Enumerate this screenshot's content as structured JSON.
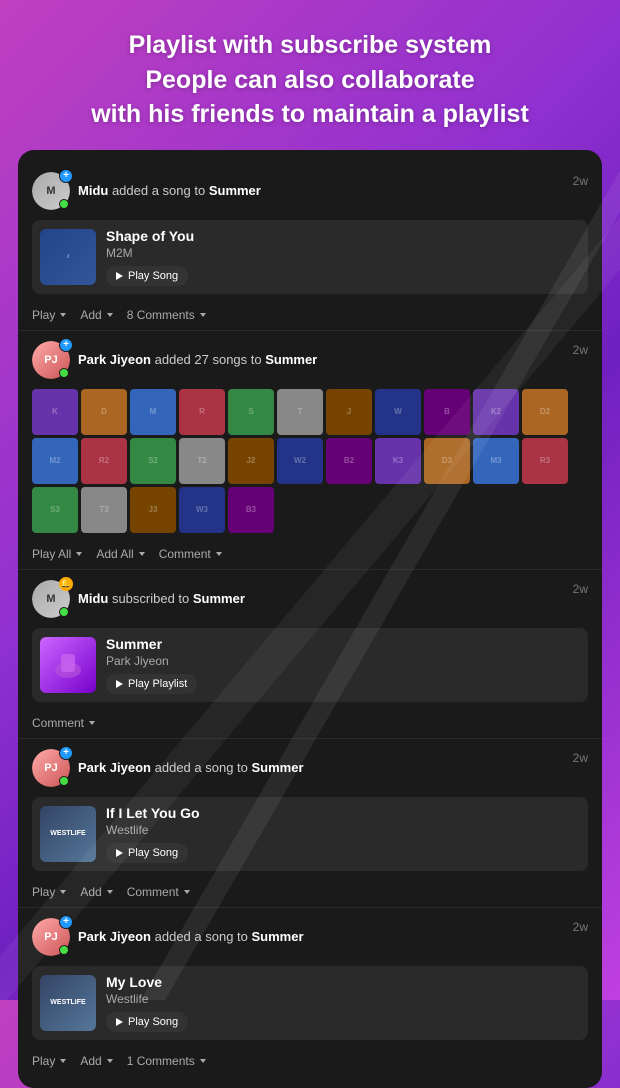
{
  "header": {
    "line1": "Playlist with subscribe system",
    "line2": "People can also collaborate",
    "line3": "with his friends to maintain a playlist"
  },
  "feed": [
    {
      "id": "feed1",
      "user": "Midu",
      "action": "added a song to",
      "target": "Summer",
      "type": "song",
      "song": {
        "title": "Shape of You",
        "artist": "M2M",
        "play_label": "Play Song"
      },
      "actions": {
        "play": "Play",
        "add": "Add",
        "comments": "8 Comments"
      },
      "time": "2w"
    },
    {
      "id": "feed2",
      "user": "Park Jiyeon",
      "action": "added 27 songs to",
      "target": "Summer",
      "type": "grid",
      "actions": {
        "play_all": "Play All",
        "add_all": "Add All",
        "comment": "Comment"
      },
      "time": "2w"
    },
    {
      "id": "feed3",
      "user": "Midu",
      "action": "subscribed to",
      "target": "Summer",
      "type": "playlist",
      "playlist": {
        "name": "Summer",
        "owner": "Park Jiyeon",
        "play_label": "Play Playlist"
      },
      "actions": {
        "comment": "Comment"
      },
      "time": "2w"
    },
    {
      "id": "feed4",
      "user": "Park Jiyeon",
      "action": "added a song to",
      "target": "Summer",
      "type": "song",
      "song": {
        "title": "If I Let You Go",
        "artist": "Westlife",
        "play_label": "Play Song"
      },
      "actions": {
        "play": "Play",
        "add": "Add",
        "comments": "Comment"
      },
      "time": "2w"
    },
    {
      "id": "feed5",
      "user": "Park Jiyeon",
      "action": "added a song to",
      "target": "Summer",
      "type": "song",
      "song": {
        "title": "My Love",
        "artist": "Westlife",
        "play_label": "Play Song"
      },
      "actions": {
        "play": "Play",
        "add": "Add",
        "comments": "1 Comments"
      },
      "time": "2w"
    }
  ],
  "album_colors": [
    "c1",
    "c2",
    "c3",
    "c4",
    "c5",
    "c6",
    "c7",
    "c8",
    "c9",
    "c1",
    "c2",
    "c3",
    "c4",
    "c5",
    "c6",
    "c7",
    "c8",
    "c9",
    "c1",
    "c2",
    "c3",
    "c4",
    "c5",
    "c6",
    "c7",
    "c8",
    "c9"
  ]
}
